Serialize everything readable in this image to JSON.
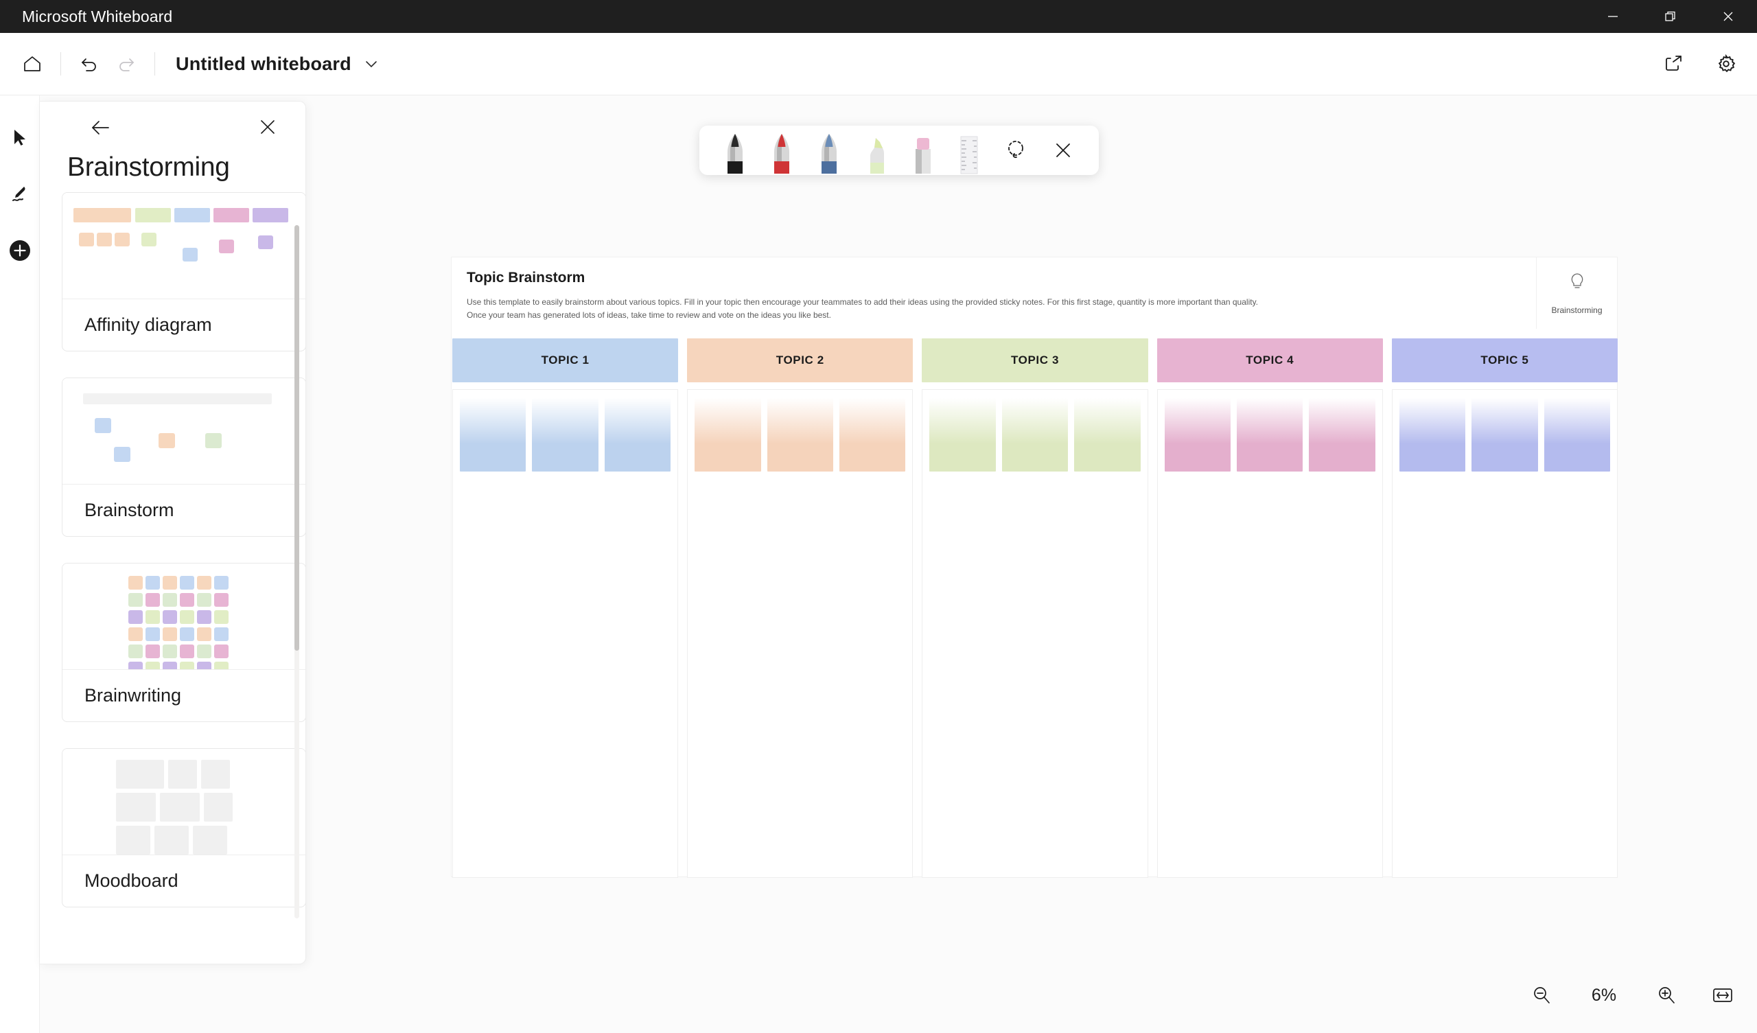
{
  "window": {
    "app_title": "Microsoft Whiteboard",
    "minimize_label": "Minimize",
    "restore_label": "Restore",
    "close_label": "Close"
  },
  "toolbar": {
    "home_label": "Home",
    "undo_label": "Undo",
    "redo_label": "Redo",
    "document_title": "Untitled whiteboard",
    "title_menu_label": "Whiteboard options",
    "share_label": "Share",
    "settings_label": "Settings"
  },
  "toolrail": {
    "select_label": "Select",
    "ink_label": "Ink",
    "create_label": "Create"
  },
  "panel": {
    "back_label": "Back",
    "close_label": "Close",
    "title": "Brainstorming",
    "templates": [
      {
        "label": "Affinity diagram"
      },
      {
        "label": "Brainstorm"
      },
      {
        "label": "Brainwriting"
      },
      {
        "label": "Moodboard"
      }
    ]
  },
  "pen_toolbar": {
    "tools": [
      {
        "name": "black-pen",
        "label": "Black pen"
      },
      {
        "name": "red-pen",
        "label": "Red pen"
      },
      {
        "name": "blue-pen",
        "label": "Blue pen"
      },
      {
        "name": "green-highlighter",
        "label": "Yellow-green highlighter"
      },
      {
        "name": "pink-highlighter",
        "label": "Pink highlighter"
      },
      {
        "name": "ruler",
        "label": "Ruler"
      }
    ],
    "lasso_label": "Lasso select",
    "close_label": "Close ink toolbar"
  },
  "canvas": {
    "frame_title": "Topic Brainstorm",
    "frame_description": "Use this template to easily brainstorm about various topics. Fill in your topic then encourage your teammates to add their ideas using the provided sticky notes. For this first stage, quantity is more important than quality. Once your team has generated lots of ideas, take time to review and vote on the ideas you like best.",
    "badge_label": "Brainstorming",
    "columns": [
      {
        "title": "TOPIC 1",
        "header_color": "#bed4ef",
        "note_color": "#bcd2ee",
        "notes": 3
      },
      {
        "title": "TOPIC 2",
        "header_color": "#f6d5bd",
        "note_color": "#f5d3bb",
        "notes": 3
      },
      {
        "title": "TOPIC 3",
        "header_color": "#dfeac3",
        "note_color": "#dde8c0",
        "notes": 3
      },
      {
        "title": "TOPIC 4",
        "header_color": "#e7b3d1",
        "note_color": "#e4afcd",
        "notes": 3
      },
      {
        "title": "TOPIC 5",
        "header_color": "#b7bdf0",
        "note_color": "#b4bbee",
        "notes": 3
      }
    ]
  },
  "zoom_controls": {
    "zoom_out_label": "Zoom out",
    "zoom_level": "6%",
    "zoom_in_label": "Zoom in",
    "fit_label": "Fit to screen"
  }
}
